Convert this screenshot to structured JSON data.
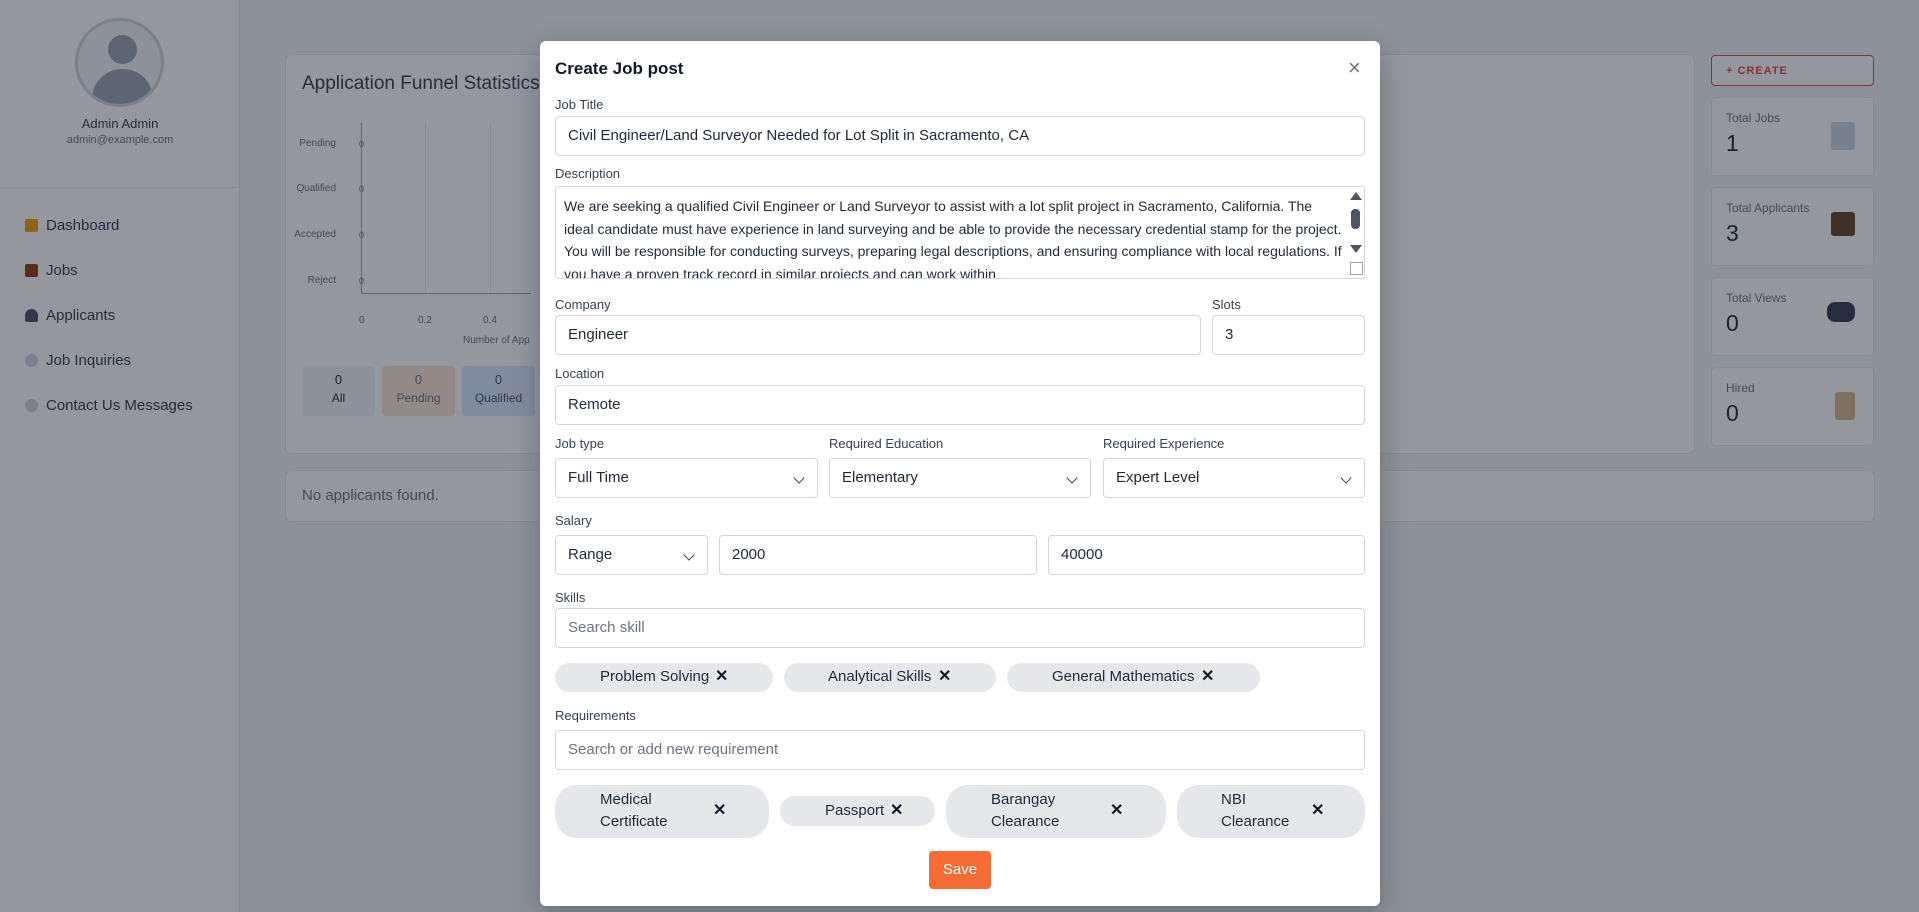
{
  "sidebar": {
    "admin_name": "Admin Admin",
    "admin_email": "admin@example.com",
    "items": [
      {
        "label": "Dashboard",
        "icon": "chart-icon"
      },
      {
        "label": "Jobs",
        "icon": "briefcase-icon"
      },
      {
        "label": "Applicants",
        "icon": "person-icon"
      },
      {
        "label": "Job Inquiries",
        "icon": "speech-bubble-icon"
      },
      {
        "label": "Contact Us Messages",
        "icon": "speech-bubble-icon"
      }
    ]
  },
  "funnel": {
    "title": "Application Funnel Statistics",
    "categories": [
      "Pending",
      "Qualified",
      "Accepted",
      "Reject"
    ],
    "values": [
      0,
      0,
      0,
      0
    ],
    "x_ticks": [
      "0",
      "0.2",
      "0.4"
    ],
    "x_label": "Number of App",
    "counts": [
      {
        "value": "0",
        "label": "All"
      },
      {
        "value": "0",
        "label": "Pending"
      },
      {
        "value": "0",
        "label": "Qualified"
      }
    ],
    "no_applicants": "No applicants found."
  },
  "stats": {
    "create_label": "+ CREATE",
    "cards": [
      {
        "label": "Total Jobs",
        "value": "1",
        "icon": "document-icon"
      },
      {
        "label": "Total Applicants",
        "value": "3",
        "icon": "briefcase-icon"
      },
      {
        "label": "Total Views",
        "value": "0",
        "icon": "binoculars-icon"
      },
      {
        "label": "Hired",
        "value": "0",
        "icon": "hourglass-icon"
      }
    ]
  },
  "modal": {
    "title": "Create Job post",
    "close_label": "×",
    "job_title_label": "Job Title",
    "job_title_value": "Civil Engineer/Land Surveyor Needed for Lot Split in Sacramento, CA",
    "description_label": "Description",
    "description_value": "We are seeking a qualified Civil Engineer or Land Surveyor to assist with a lot split project in Sacramento, California. The ideal candidate must have experience in land surveying and be able to provide the necessary credential stamp for the project. You will be responsible for conducting surveys, preparing legal descriptions, and ensuring compliance with local regulations. If you have a proven track record in similar projects and can work within",
    "company_label": "Company",
    "company_value": "Engineer",
    "slots_label": "Slots",
    "slots_value": "3",
    "location_label": "Location",
    "location_value": "Remote",
    "job_type_label": "Job type",
    "job_type_value": "Full Time",
    "education_label": "Required Education",
    "education_value": "Elementary",
    "experience_label": "Required Experience",
    "experience_value": "Expert Level",
    "salary_label": "Salary",
    "salary_type_value": "Range",
    "salary_min_value": "2000",
    "salary_max_value": "40000",
    "skills_label": "Skills",
    "skills_placeholder": "Search skill",
    "skills": [
      "Problem Solving",
      "Analytical Skills",
      "General Mathematics"
    ],
    "requirements_label": "Requirements",
    "requirements_placeholder": "Search or add new requirement",
    "requirements": [
      "Medical Certificate",
      "Passport",
      "Barangay Clearance",
      "NBI Clearance"
    ],
    "remove_glyph": "✕",
    "save_label": "Save"
  }
}
